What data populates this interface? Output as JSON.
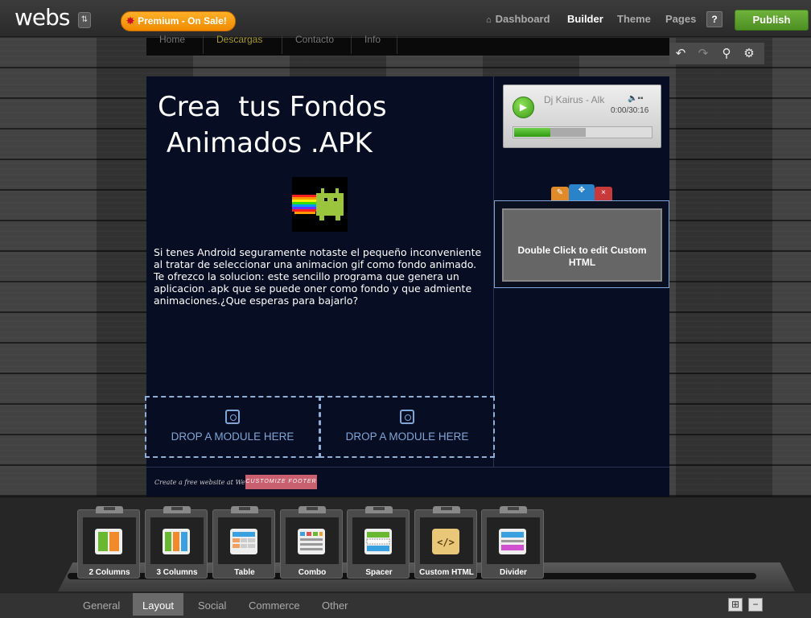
{
  "topbar": {
    "logo": "webs",
    "premium_label": "Premium - On Sale!",
    "nav": {
      "dashboard": "Dashboard",
      "builder": "Builder",
      "theme": "Theme",
      "pages": "Pages"
    },
    "help": "?",
    "publish": "Publish"
  },
  "icons": {
    "home": "home-icon",
    "undo": "undo-icon",
    "redo": "redo-icon",
    "search": "search-icon",
    "settings": "gear-icon"
  },
  "site": {
    "menu": [
      "Home",
      "Descargas",
      "Contacto",
      "Info"
    ],
    "title": "Crea  tus Fondos\n Animados .APK",
    "body": "Si tenes Android seguramente notaste el pequeño inconveniente al tratar de seleccionar una animacion gif como fondo animado. Te ofrezco la solucion: este sencillo programa que genera un aplicacion .apk que se puede oner como fondo y que admiente animaciones.¿Que esperas para bajarlo?",
    "drop_left": "DROP A MODULE HERE",
    "drop_right": "DROP A MODULE HERE",
    "footer_text": "Create a free website at Webs.com",
    "customize_footer": "CUSTOMIZE FOOTER"
  },
  "player": {
    "track": "Dj Kairus - Alk",
    "time": "0:00/30:16",
    "progress": 0.26
  },
  "custom_html": {
    "text": "Double Click to edit Custom HTML"
  },
  "modules": [
    {
      "label": "2 Columns",
      "icon": "two-columns-icon"
    },
    {
      "label": "3 Columns",
      "icon": "three-columns-icon"
    },
    {
      "label": "Table",
      "icon": "table-icon"
    },
    {
      "label": "Combo",
      "icon": "combo-icon"
    },
    {
      "label": "Spacer",
      "icon": "spacer-icon"
    },
    {
      "label": "Custom HTML",
      "icon": "code-icon"
    },
    {
      "label": "Divider",
      "icon": "divider-icon"
    }
  ],
  "bottom_tabs": [
    "General",
    "Layout",
    "Social",
    "Commerce",
    "Other"
  ],
  "active_tab": "Layout",
  "colors": {
    "publish": "#5a9e2c",
    "premium": "#f7a21b",
    "page_bg": "#070d22",
    "drop_border": "#8fb0d6"
  }
}
